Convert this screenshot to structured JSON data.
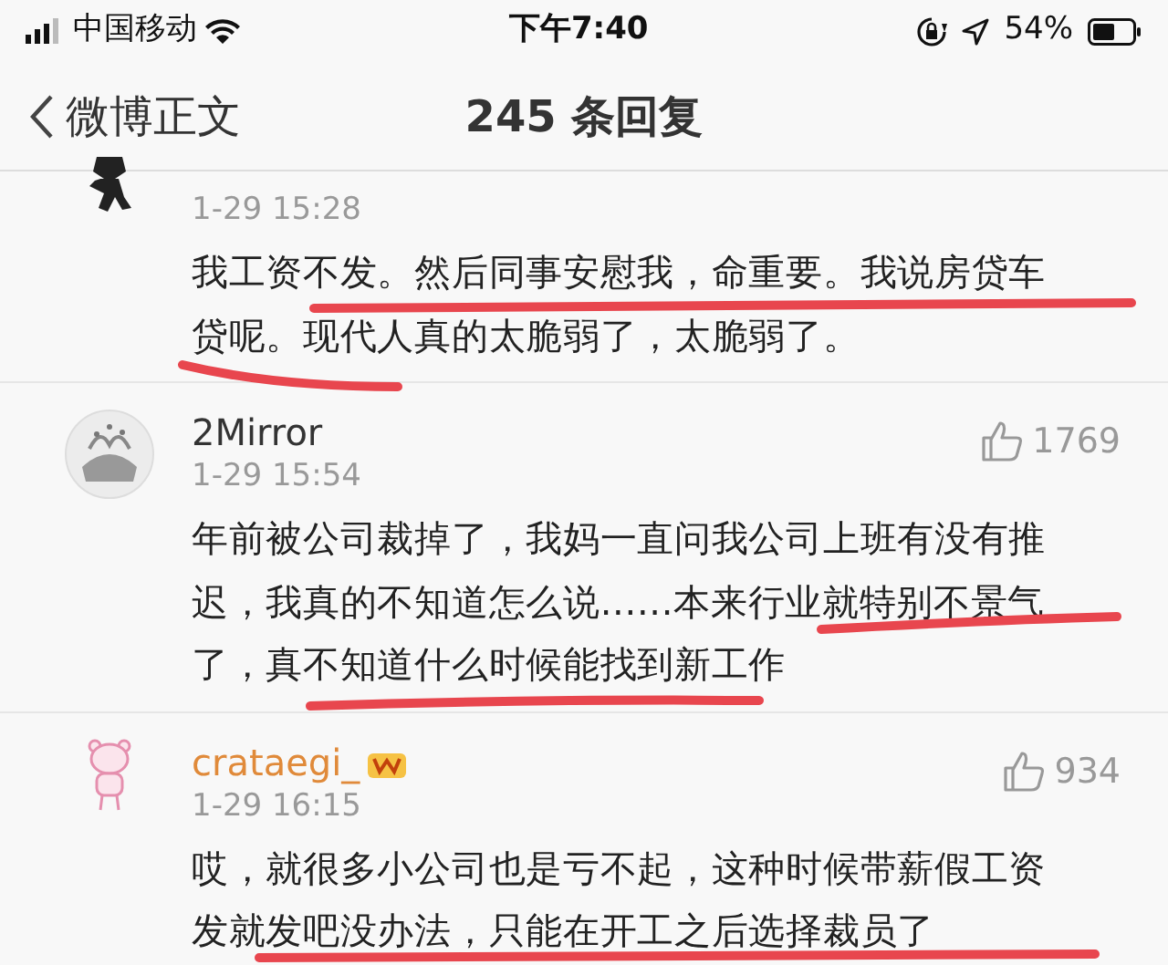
{
  "status_bar": {
    "carrier": "中国移动",
    "time": "下午7:40",
    "battery": "54%"
  },
  "nav": {
    "back_label": "微博正文",
    "title": "245 条回复"
  },
  "comments": [
    {
      "avatar": {
        "kind": "figure"
      },
      "time": "1-29 15:28",
      "lines": [
        "我工资不发。然后同事安慰我，命重要。我说房贷车",
        "贷呢。现代人真的太脆弱了，太脆弱了。"
      ]
    },
    {
      "username": "2Mirror",
      "vip": false,
      "avatar": {
        "kind": "round"
      },
      "time": "1-29 15:54",
      "likes": "1769",
      "lines": [
        "年前被公司裁掉了，我妈一直问我公司上班有没有推",
        "迟，我真的不知道怎么说......本来行业就特别不景气",
        "了，真不知道什么时候能找到新工作"
      ]
    },
    {
      "username": "crataegi_",
      "vip": true,
      "avatar": {
        "kind": "panda"
      },
      "time": "1-29 16:15",
      "likes": "934",
      "lines": [
        "哎，就很多小公司也是亏不起，这种时候带薪假工资",
        "发就发吧没办法，只能在开工之后选择裁员了"
      ]
    }
  ]
}
